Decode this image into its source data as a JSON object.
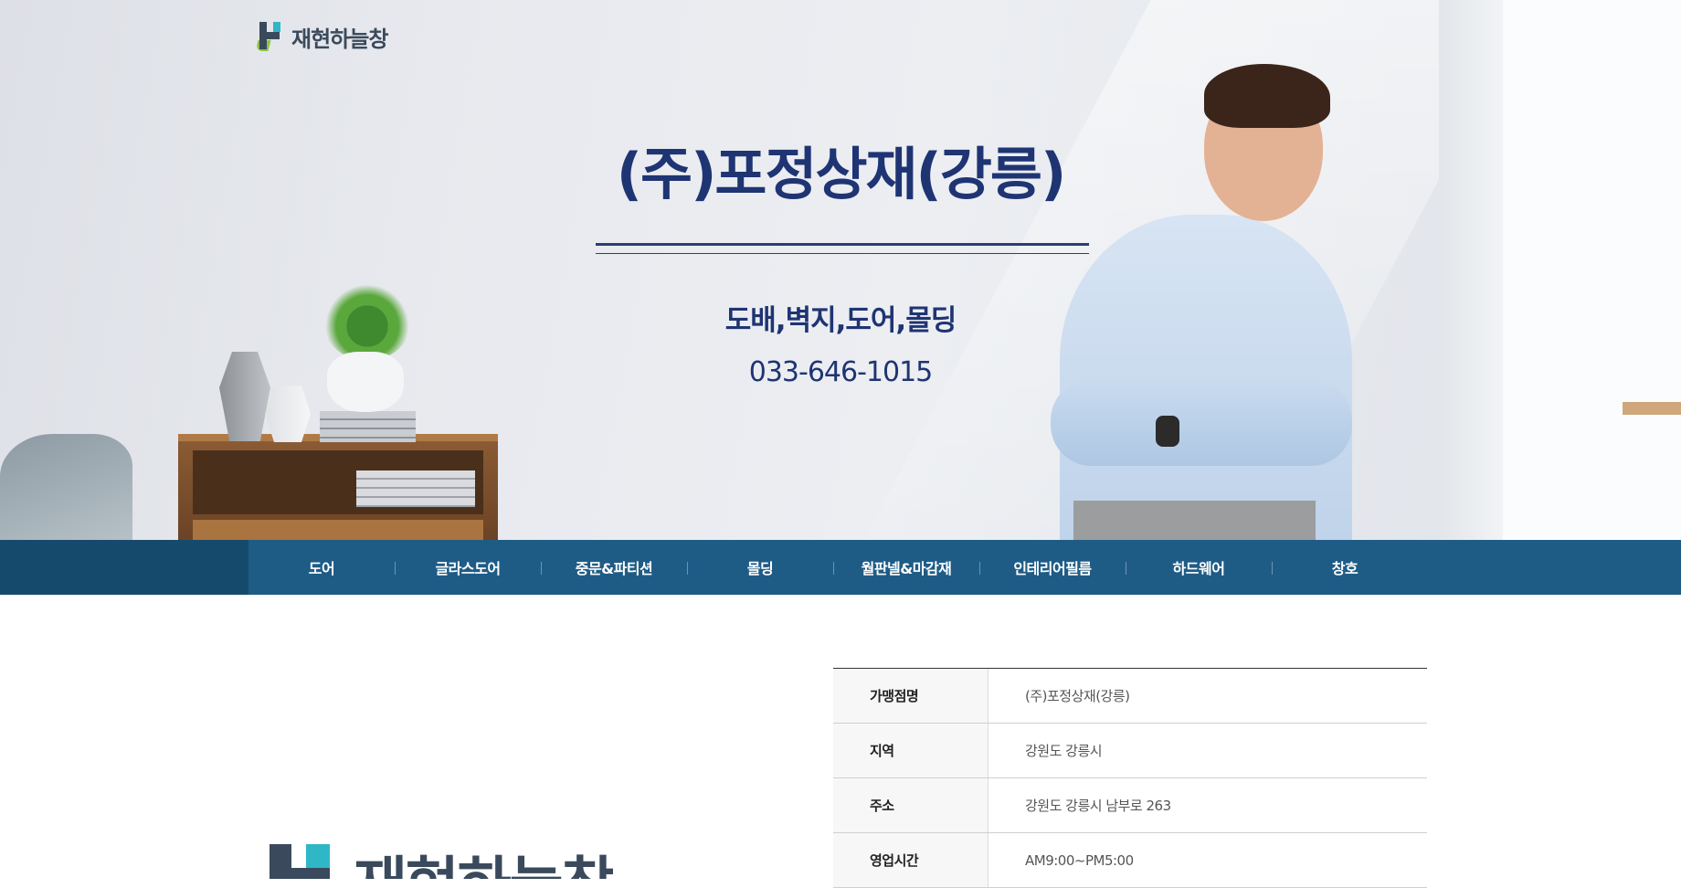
{
  "header": {
    "logo_text": "재현하늘창",
    "title": "(주)포정상재(강릉)",
    "subtitle": "도배,벽지,도어,몰딩",
    "phone": "033-646-1015"
  },
  "nav": {
    "items": [
      {
        "label": "도어"
      },
      {
        "label": "글라스도어"
      },
      {
        "label": "중문&파티션"
      },
      {
        "label": "몰딩"
      },
      {
        "label": "월판넬&마감재"
      },
      {
        "label": "인테리어필름"
      },
      {
        "label": "하드웨어"
      },
      {
        "label": "창호"
      }
    ]
  },
  "brand_logo": {
    "text": "재현하늘창"
  },
  "info_table": {
    "rows": [
      {
        "label": "가맹점명",
        "value": "(주)포정상재(강릉)"
      },
      {
        "label": "지역",
        "value": "강원도 강릉시"
      },
      {
        "label": "주소",
        "value": "강원도 강릉시 남부로 263"
      },
      {
        "label": "영업시간",
        "value": "AM9:00~PM5:00"
      }
    ]
  },
  "colors": {
    "navy_text": "#1f3473",
    "nav_bar": "#1e5c86",
    "nav_lead": "#164a6d",
    "logo_teal": "#2fb7c6",
    "logo_green": "#8cc63f"
  },
  "icons": [
    "logo-mark-icon"
  ]
}
